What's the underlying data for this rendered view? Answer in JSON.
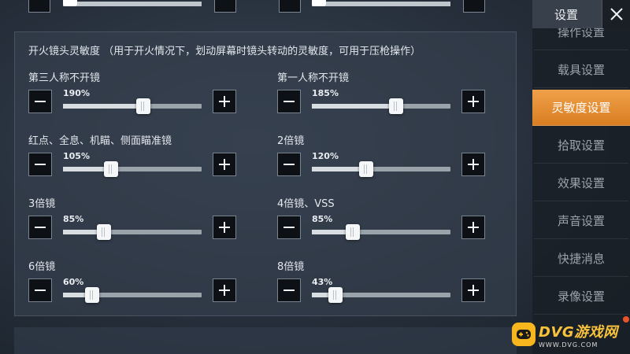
{
  "sidebar": {
    "title": "设置",
    "items": [
      {
        "label": "操作设置",
        "active": false
      },
      {
        "label": "载具设置",
        "active": false
      },
      {
        "label": "灵敏度设置",
        "active": true
      },
      {
        "label": "拾取设置",
        "active": false
      },
      {
        "label": "效果设置",
        "active": false
      },
      {
        "label": "声音设置",
        "active": false
      },
      {
        "label": "快捷消息",
        "active": false
      },
      {
        "label": "录像设置",
        "active": false
      }
    ]
  },
  "section": {
    "title": "开火镜头灵敏度 （用于开火情况下，划动屏幕时镜头转动的灵敏度，可用于压枪操作）"
  },
  "settings": [
    {
      "label": "第三人称不开镜",
      "value": "190%",
      "level": 0.59
    },
    {
      "label": "第一人称不开镜",
      "value": "185%",
      "level": 0.62
    },
    {
      "label": "红点、全息、机瞄、侧面瞄准镜",
      "value": "105%",
      "level": 0.33
    },
    {
      "label": "2倍镜",
      "value": "120%",
      "level": 0.38
    },
    {
      "label": "3倍镜",
      "value": "85%",
      "level": 0.27
    },
    {
      "label": "4倍镜、VSS",
      "value": "85%",
      "level": 0.27
    },
    {
      "label": "6倍镜",
      "value": "60%",
      "level": 0.18
    },
    {
      "label": "8倍镜",
      "value": "43%",
      "level": 0.13
    }
  ],
  "watermark": {
    "main": "DVG游戏网",
    "sub": "WWW.DVG.COM"
  },
  "colors": {
    "accent": "#e8902f",
    "panel": "#343e4c",
    "sidebar": "#191e25"
  }
}
